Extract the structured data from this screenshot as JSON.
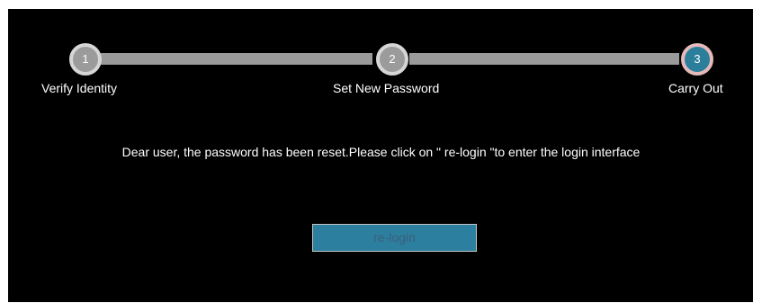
{
  "steps": [
    {
      "number": "1",
      "label": "Verify Identity",
      "state": "completed"
    },
    {
      "number": "2",
      "label": "Set New Password",
      "state": "completed"
    },
    {
      "number": "3",
      "label": "Carry Out",
      "state": "active"
    }
  ],
  "message": "Dear user, the password has been reset.Please click on \" re-login \"to enter the login interface",
  "relogin_button": {
    "label": "re-login"
  },
  "colors": {
    "panel_background": "#000000",
    "step_circle_completed": "#9b9b9b",
    "step_circle_active": "#2b7f9b",
    "progress_bar": "#9a9a9a",
    "button_background": "#2d7fa0"
  }
}
